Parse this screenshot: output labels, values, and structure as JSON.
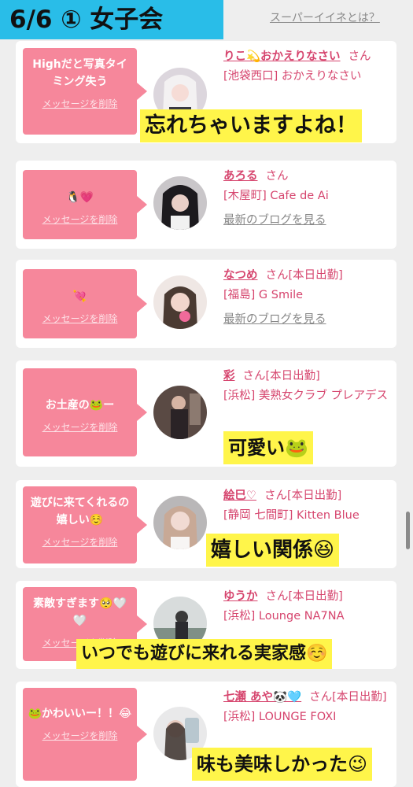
{
  "page_title": "6/6 ① 女子会",
  "super_link": "スーパーイイネとは？",
  "delete_label": "メッセージを削除",
  "blog_label": "最新のブログを見る",
  "colors": {
    "bubble": "#f6879b",
    "title_bg": "#29bde8",
    "caption_bg": "#fff54a",
    "name": "#d6456e"
  },
  "cards": [
    {
      "message": "Highだと写真タイミング失う",
      "name": "りこ💫おかえりなさい",
      "san": "さん",
      "status": "",
      "store": "[池袋西口] おかえりなさい",
      "blog": false,
      "caption": "忘れちゃいますよね！"
    },
    {
      "message": "🐧💗",
      "name": "あろる",
      "san": "さん",
      "status": "",
      "store": "[木屋町] Cafe de Ai",
      "blog": true,
      "caption": ""
    },
    {
      "message": "💘",
      "name": "なつめ",
      "san": "さん",
      "status": "[本日出勤]",
      "store": "[福島] G Smile",
      "blog": true,
      "caption": ""
    },
    {
      "message": "お土産の🐸ー",
      "name": "彩",
      "san": "さん",
      "status": "[本日出勤]",
      "store": "[浜松] 美熟女クラブ プレアデス",
      "blog": false,
      "caption": "可愛い🐸"
    },
    {
      "message": "遊びに来てくれるの嬉しい☺️",
      "name": "絵巳♡",
      "san": "さん",
      "status": "[本日出勤]",
      "store": "[静岡 七間町] Kitten Blue",
      "blog": false,
      "caption": "嬉しい関係😆"
    },
    {
      "message": "素敵すぎます🥺🤍🤍",
      "name": "ゆうか",
      "san": "さん",
      "status": "[本日出勤]",
      "store": "[浜松] Lounge NA7NA",
      "blog": false,
      "caption": "いつでも遊びに来れる実家感☺️"
    },
    {
      "message": "🐸かわいいー！！😂",
      "name": "七瀬 あや🐼🩵",
      "san": "さん",
      "status": "[本日出勤]",
      "store": "[浜松] LOUNGE FOXI",
      "blog": false,
      "caption": "味も美味しかった😉"
    }
  ]
}
